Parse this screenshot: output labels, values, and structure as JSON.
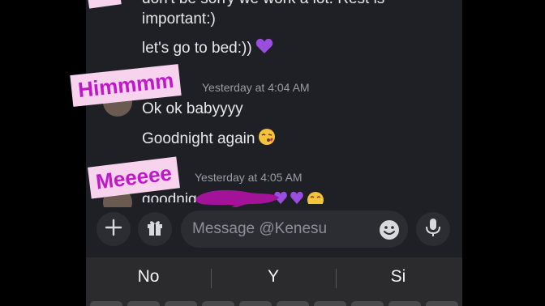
{
  "chat": {
    "messages": [
      {
        "text": "don't be sorry we work a lot. Rest is"
      },
      {
        "text": "important:)"
      },
      {
        "text": "let's go to bed:))"
      },
      {
        "timestamp": "Yesterday at 4:04 AM"
      },
      {
        "text": "Ok ok babyyyy"
      },
      {
        "text": "Goodnight again"
      },
      {
        "timestamp": "Yesterday at 4:05 AM"
      },
      {
        "text": "goodnig"
      }
    ],
    "stickers": {
      "first": "Himmmm",
      "second": "Meeeee"
    }
  },
  "composer": {
    "placeholder": "Message @Kenesu"
  },
  "icons": {
    "add": "plus-icon",
    "gift": "gift-icon",
    "emoji": "emoji-icon",
    "mic": "microphone-icon"
  },
  "keyboard": {
    "suggestions": [
      "No",
      "Y",
      "Si"
    ]
  },
  "colors": {
    "background": "#1f2025",
    "sticker_bg": "#f7d3ee",
    "sticker_text": "#c018c8",
    "scribble": "#a3139a"
  }
}
